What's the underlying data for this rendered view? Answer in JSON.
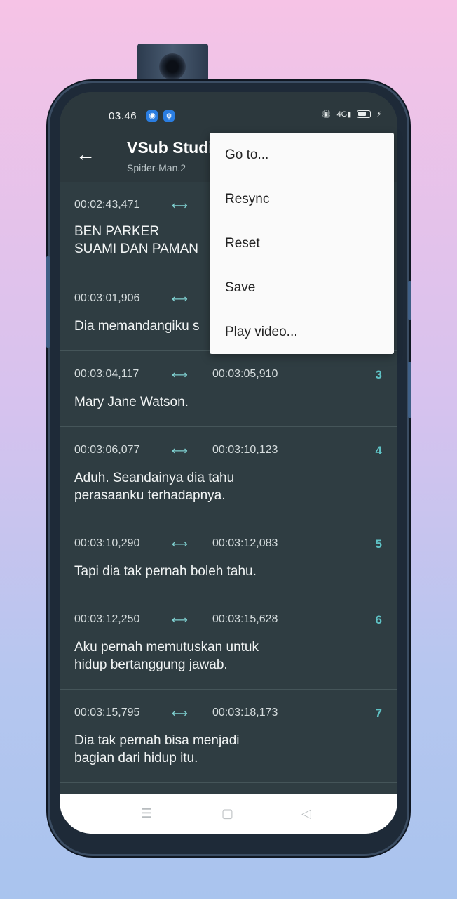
{
  "status_bar": {
    "time": "03.46",
    "icons": [
      "android-icon",
      "usb-icon",
      "vibrate-icon",
      "signal-4g-icon",
      "battery-icon",
      "charging-icon"
    ],
    "network_label": "4G"
  },
  "app_bar": {
    "title": "VSub Studio",
    "subtitle": "Spider-Man.2"
  },
  "subtitles": [
    {
      "start": "00:02:43,471",
      "end": "",
      "index": "",
      "text": "BEN PARKER\nSUAMI DAN PAMAN"
    },
    {
      "start": "00:03:01,906",
      "end": "",
      "index": "",
      "text": "Dia memandangiku s"
    },
    {
      "start": "00:03:04,117",
      "end": "00:03:05,910",
      "index": "3",
      "text": "Mary Jane Watson."
    },
    {
      "start": "00:03:06,077",
      "end": "00:03:10,123",
      "index": "4",
      "text": "Aduh. Seandainya dia tahu\nperasaanku terhadapnya."
    },
    {
      "start": "00:03:10,290",
      "end": "00:03:12,083",
      "index": "5",
      "text": "Tapi dia tak pernah boleh tahu."
    },
    {
      "start": "00:03:12,250",
      "end": "00:03:15,628",
      "index": "6",
      "text": "Aku pernah memutuskan untuk\nhidup bertanggung jawab."
    },
    {
      "start": "00:03:15,795",
      "end": "00:03:18,173",
      "index": "7",
      "text": "Dia tak pernah bisa menjadi\nbagian dari hidup itu."
    }
  ],
  "menu": {
    "items": [
      "Go to...",
      "Resync",
      "Reset",
      "Save",
      "Play video..."
    ]
  },
  "colors": {
    "background": "#2f3d42",
    "accent": "#5fc3c6",
    "menu_bg": "#fafafa"
  }
}
